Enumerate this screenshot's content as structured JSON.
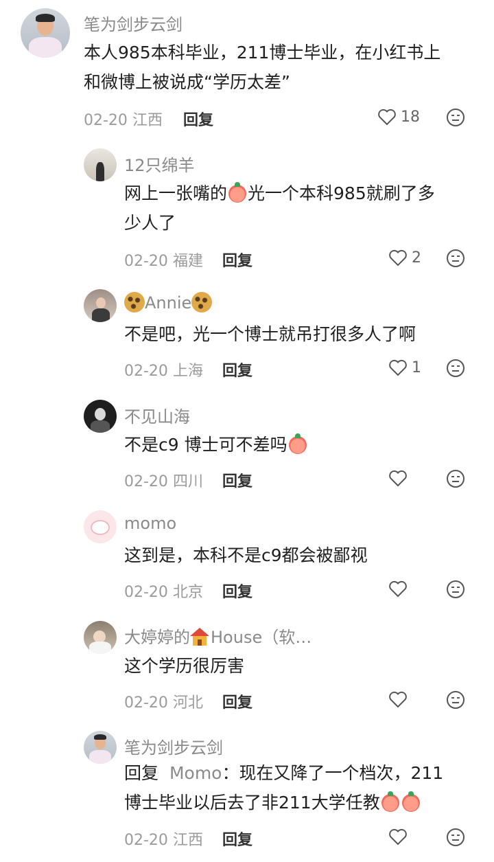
{
  "comments": [
    {
      "nick": "笔为剑步云剑",
      "text_lines": [
        "本人985本科毕业，211博士毕业，在小红书上",
        "和微博上被说成“学历太差”"
      ],
      "date": "02-20",
      "location": "江西",
      "reply_label": "回复",
      "likes": "18"
    },
    {
      "nick": "12只绵羊",
      "text_parts": [
        "网上一张嘴的",
        "光一个本科985就刷了多"
      ],
      "text_line2": "少人了",
      "date": "02-20",
      "location": "福建",
      "reply_label": "回复",
      "likes": "2"
    },
    {
      "nick": "Annie",
      "text": "不是吧，光一个博士就吊打很多人了啊",
      "date": "02-20",
      "location": "上海",
      "reply_label": "回复",
      "likes": "1"
    },
    {
      "nick": "不见山海",
      "text": "不是c9  博士可不差吗",
      "date": "02-20",
      "location": "四川",
      "reply_label": "回复",
      "likes": ""
    },
    {
      "nick": "momo",
      "text": "这到是，本科不是c9都会被鄙视",
      "date": "02-20",
      "location": "北京",
      "reply_label": "回复",
      "likes": ""
    },
    {
      "nick_prefix": "大婷婷的",
      "nick_suffix": "House（软…",
      "text": "这个学历很厉害",
      "date": "02-20",
      "location": "河北",
      "reply_label": "回复",
      "likes": ""
    },
    {
      "nick": "笔为剑步云剑",
      "reply_prefix": "回复",
      "reply_to": "Momo",
      "text_line1": "：现在又降了一个档次，211",
      "text_line2": "博士毕业以后去了非211大学任教",
      "date": "02-20",
      "location": "江西",
      "reply_label": "回复",
      "likes": ""
    }
  ],
  "icons": {
    "like": "heart-outline-icon",
    "dislike": "neutral-face-icon"
  }
}
